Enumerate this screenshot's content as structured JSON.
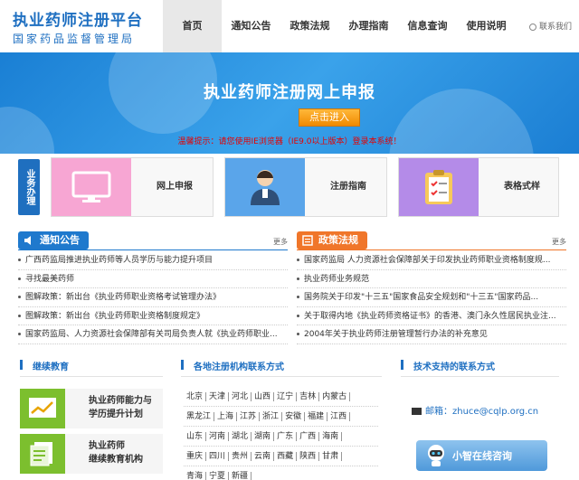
{
  "header": {
    "title": "执业药师注册平台",
    "subtitle": "国家药品监督管理局",
    "nav": [
      {
        "label": "首页",
        "active": true
      },
      {
        "label": "通知公告",
        "active": false
      },
      {
        "label": "政策法规",
        "active": false
      },
      {
        "label": "办理指南",
        "active": false
      },
      {
        "label": "信息查询",
        "active": false
      },
      {
        "label": "使用说明",
        "active": false
      }
    ],
    "contact": "联系我们"
  },
  "banner": {
    "title": "执业药师注册网上申报",
    "button": "点击进入",
    "notice": "温馨提示：请您使用IE浏览器（IE9.0以上版本）登录本系统！"
  },
  "business": {
    "label": "业务办理",
    "items": [
      {
        "label": "网上申报",
        "icon": "monitor-icon",
        "color": "#f7a6d3"
      },
      {
        "label": "注册指南",
        "icon": "user-icon",
        "color": "#5aa5ea"
      },
      {
        "label": "表格式样",
        "icon": "clipboard-icon",
        "color": "#b48be8"
      }
    ]
  },
  "notices": {
    "title": "通知公告",
    "more": "更多",
    "items": [
      "广西药监局推进执业药师等人员学历与能力提升项目",
      "寻找最美药师",
      "图解政策：新出台《执业药师职业资格考试管理办法》",
      "图解政策：新出台《执业药师职业资格制度规定》",
      "国家药监局、人力资源社会保障部有关司局负责人就《执业药师职业..."
    ]
  },
  "policies": {
    "title": "政策法规",
    "more": "更多",
    "items": [
      "国家药监局 人力资源社会保障部关于印发执业药师职业资格制度规...",
      "执业药师业务规范",
      "国务院关于印发\"十三五\"国家食品安全规划和\"十三五\"国家药品...",
      "关于取得内地《执业药师资格证书》的香港、澳门永久性居民执业注...",
      "2004年关于执业药师注册管理暂行办法的补充意见"
    ]
  },
  "education": {
    "title": "继续教育",
    "items": [
      {
        "line1": "执业药师能力与",
        "line2": "学历提升计划"
      },
      {
        "line1": "执业药师",
        "line2": "继续教育机构"
      }
    ]
  },
  "regions": {
    "title": "各地注册机构联系方式",
    "rows": [
      [
        "北京",
        "天津",
        "河北",
        "山西",
        "辽宁",
        "吉林",
        "内蒙古"
      ],
      [
        "黑龙江",
        "上海",
        "江苏",
        "浙江",
        "安徽",
        "福建",
        "江西"
      ],
      [
        "山东",
        "河南",
        "湖北",
        "湖南",
        "广东",
        "广西",
        "海南"
      ],
      [
        "重庆",
        "四川",
        "贵州",
        "云南",
        "西藏",
        "陕西",
        "甘肃"
      ],
      [
        "青海",
        "宁夏",
        "新疆"
      ]
    ]
  },
  "support": {
    "title": "技术支持的联系方式",
    "email": "邮箱：zhuce@cqlp.org.cn",
    "chat": "小智在线咨询"
  }
}
